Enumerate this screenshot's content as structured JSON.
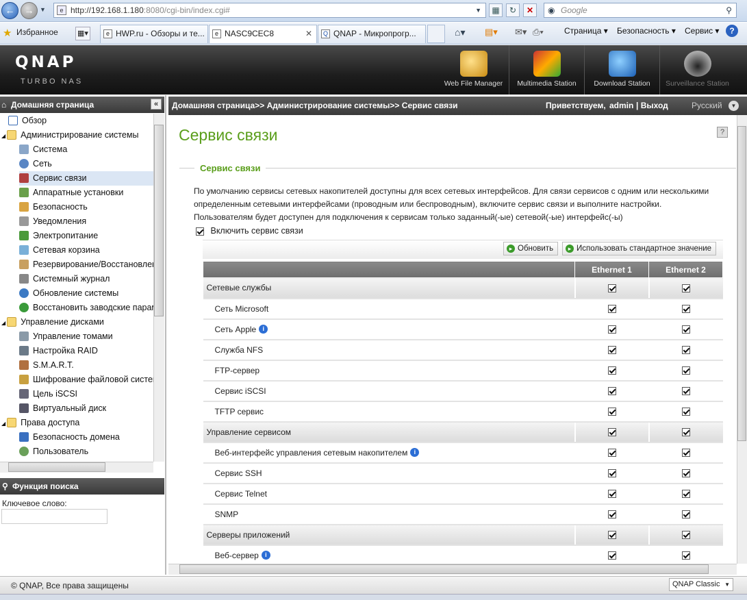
{
  "browser": {
    "url_host": "http://192.168.1.180",
    "url_path": ":8080/cgi-bin/index.cgi#",
    "search_placeholder": "Google",
    "favorites_label": "Избранное",
    "tabs": [
      {
        "label": "HWP.ru - Обзоры и те..."
      },
      {
        "label": "NASC9CEC8"
      },
      {
        "label": "QNAP - Микропрогр..."
      }
    ],
    "commands": {
      "page": "Страница ▾",
      "security": "Безопасность ▾",
      "service": "Сервис ▾",
      "help": "?"
    }
  },
  "header": {
    "logo": "QNAP",
    "logo_sub": "TURBO NAS",
    "stations": [
      {
        "label": "Web File Manager"
      },
      {
        "label": "Multimedia Station"
      },
      {
        "label": "Download Station"
      },
      {
        "label": "Surveillance Station"
      }
    ]
  },
  "sidebar": {
    "home": "Домашняя страница",
    "collapse": "«",
    "items": [
      {
        "label": "Обзор"
      },
      {
        "label": "Администрирование системы"
      },
      {
        "label": "Система"
      },
      {
        "label": "Сеть"
      },
      {
        "label": "Сервис связи"
      },
      {
        "label": "Аппаратные установки"
      },
      {
        "label": "Безопасность"
      },
      {
        "label": "Уведомления"
      },
      {
        "label": "Электропитание"
      },
      {
        "label": "Сетевая корзина"
      },
      {
        "label": "Резервирование/Восстановлен"
      },
      {
        "label": "Системный журнал"
      },
      {
        "label": "Обновление системы"
      },
      {
        "label": "Восстановить заводские парам"
      },
      {
        "label": "Управление дисками"
      },
      {
        "label": "Управление томами"
      },
      {
        "label": "Настройка RAID"
      },
      {
        "label": "S.M.A.R.T."
      },
      {
        "label": "Шифрование файловой систем"
      },
      {
        "label": "Цель iSCSI"
      },
      {
        "label": "Виртуальный диск"
      },
      {
        "label": "Права доступа"
      },
      {
        "label": "Безопасность домена"
      },
      {
        "label": "Пользователь"
      }
    ],
    "search_title": "Функция поиска",
    "keyword_label": "Ключевое слово:"
  },
  "breadcrumb": {
    "path": "Домашняя страница>> Администрирование системы>> Сервис связи",
    "welcome": "Приветствуем,",
    "user": "admin",
    "logout": "| Выход",
    "language": "Русский"
  },
  "main": {
    "title": "Сервис связи",
    "section": "Сервис связи",
    "desc1": "По умолчанию сервисы сетевых накопителей доступны для всех сетевых интерфейсов. Для связи сервисов с одним или несколькими",
    "desc2": "определенным сетевыми интерфейсами (проводным или беспроводным), включите сервис связи и выполните настройки.",
    "desc3": "Пользователям будет доступен для подключения к сервисам только заданный(-ые) сетевой(-ые) интерфейс(-ы)",
    "enable_label": "Включить сервис связи",
    "refresh": "Обновить",
    "defaults": "Использовать стандартное значение",
    "columns": [
      "",
      "Ethernet 1",
      "Ethernet 2"
    ],
    "rows": [
      {
        "name": "Сетевые службы",
        "group": true
      },
      {
        "name": "Сеть Microsoft"
      },
      {
        "name": "Сеть Apple",
        "info": "i"
      },
      {
        "name": "Служба NFS"
      },
      {
        "name": "FTP-сервер"
      },
      {
        "name": "Сервис iSCSI"
      },
      {
        "name": "TFTP сервис"
      },
      {
        "name": "Управление сервисом",
        "group": true
      },
      {
        "name": "Веб-интерфейс управления сетевым накопителем",
        "info": "i"
      },
      {
        "name": "Сервис SSH"
      },
      {
        "name": "Сервис Telnet"
      },
      {
        "name": "SNMP"
      },
      {
        "name": "Серверы приложений",
        "group": true
      },
      {
        "name": "Веб-сервер",
        "info": "i"
      }
    ]
  },
  "footer": {
    "copyright": "© QNAP, Все права защищены",
    "skin": "QNAP Classic"
  }
}
